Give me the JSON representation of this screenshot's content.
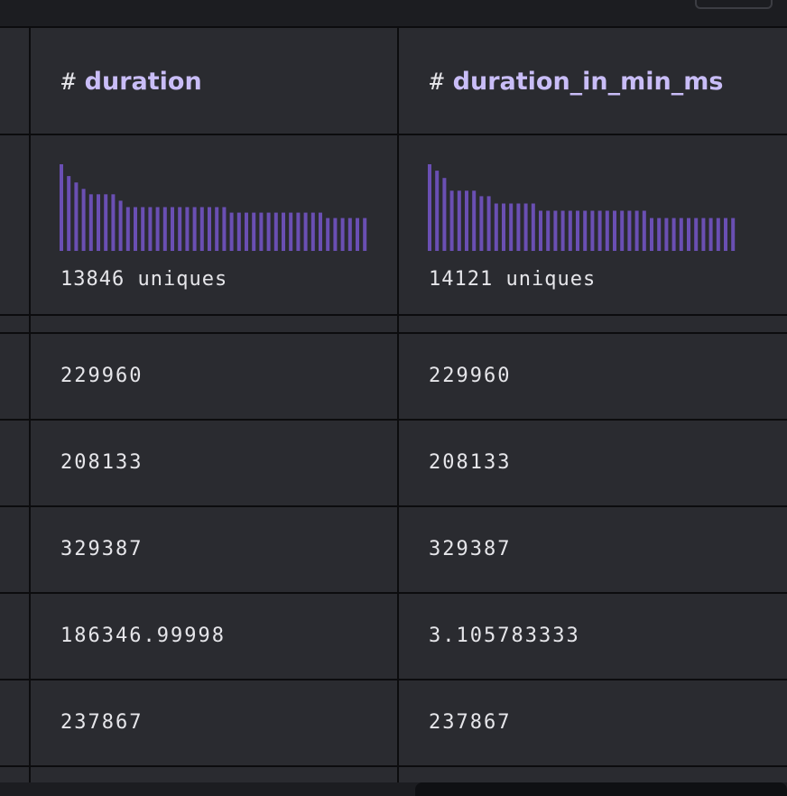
{
  "columns": [
    {
      "type_icon": "#",
      "name": "duration",
      "uniques_label": "13846 uniques",
      "histogram": [
        95,
        82,
        75,
        68,
        62,
        62,
        62,
        62,
        55,
        48,
        48,
        48,
        48,
        48,
        48,
        48,
        48,
        48,
        48,
        48,
        48,
        48,
        48,
        42,
        42,
        42,
        42,
        42,
        42,
        42,
        42,
        42,
        42,
        42,
        42,
        42,
        36,
        36,
        36,
        36,
        36,
        36
      ],
      "values": [
        "229960",
        "208133",
        "329387",
        "186346.99998",
        "237867"
      ]
    },
    {
      "type_icon": "#",
      "name": "duration_in_min_ms",
      "uniques_label": "14121 uniques",
      "histogram": [
        95,
        88,
        80,
        66,
        66,
        66,
        66,
        60,
        60,
        52,
        52,
        52,
        52,
        52,
        52,
        44,
        44,
        44,
        44,
        44,
        44,
        44,
        44,
        44,
        44,
        44,
        44,
        44,
        44,
        44,
        36,
        36,
        36,
        36,
        36,
        36,
        36,
        36,
        36,
        36,
        36,
        36
      ],
      "values": [
        "229960",
        "208133",
        "329387",
        "3.105783333",
        "237867"
      ]
    }
  ],
  "colors": {
    "header_text": "#c9bdf7",
    "histogram_bar": "#6a4fb3",
    "cell_bg": "#2a2b30",
    "grid_line": "#0c0c0e"
  }
}
